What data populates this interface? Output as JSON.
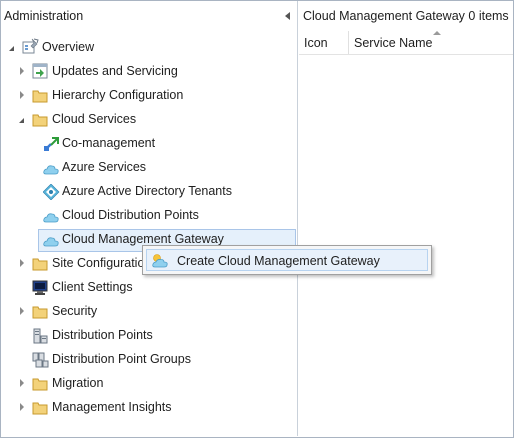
{
  "nav": {
    "title": "Administration",
    "items": [
      {
        "label": "Overview",
        "icon": "overview-icon",
        "expander": "expanded"
      },
      {
        "label": "Updates and Servicing",
        "icon": "updates-icon",
        "expander": "collapsed"
      },
      {
        "label": "Hierarchy Configuration",
        "icon": "folder-icon",
        "expander": "collapsed"
      },
      {
        "label": "Cloud Services",
        "icon": "folder-icon",
        "expander": "expanded"
      },
      {
        "label": "Co-management",
        "icon": "co-management-icon"
      },
      {
        "label": "Azure Services",
        "icon": "cloud-icon"
      },
      {
        "label": "Azure Active Directory Tenants",
        "icon": "aad-icon"
      },
      {
        "label": "Cloud Distribution Points",
        "icon": "cloud-icon"
      },
      {
        "label": "Cloud Management Gateway",
        "icon": "cloud-icon",
        "selected": true
      },
      {
        "label": "Site Configuration",
        "icon": "folder-icon",
        "expander": "collapsed"
      },
      {
        "label": "Client Settings",
        "icon": "client-settings-icon"
      },
      {
        "label": "Security",
        "icon": "folder-icon",
        "expander": "collapsed"
      },
      {
        "label": "Distribution Points",
        "icon": "distribution-point-icon"
      },
      {
        "label": "Distribution Point Groups",
        "icon": "distribution-point-group-icon"
      },
      {
        "label": "Migration",
        "icon": "folder-icon",
        "expander": "collapsed"
      },
      {
        "label": "Management Insights",
        "icon": "folder-icon",
        "expander": "collapsed"
      }
    ]
  },
  "content": {
    "title": "Cloud Management Gateway",
    "count": "0 items",
    "columns": [
      "Icon",
      "Service Name"
    ],
    "sort_column": "Service Name"
  },
  "context_menu": {
    "items": [
      {
        "label": "Create Cloud Management Gateway",
        "icon": "create-cmg-icon"
      }
    ]
  },
  "colors": {
    "selection_bg": "#e5f0fb",
    "selection_border": "#a9c5e8",
    "folder": "#e8c15b",
    "cloud": "#66b6dd"
  }
}
